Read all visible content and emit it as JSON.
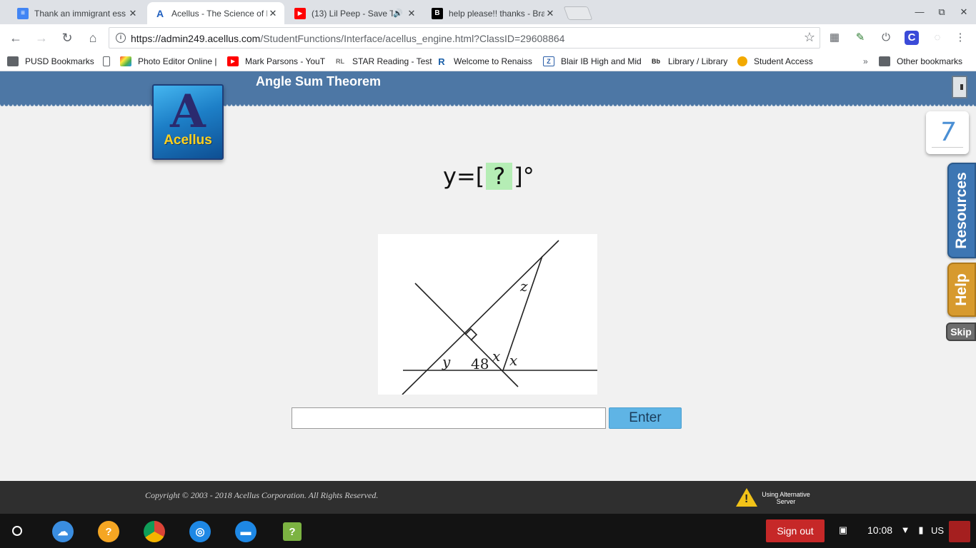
{
  "browser": {
    "tabs": [
      {
        "title": "Thank an immigrant ess",
        "favicon": "docs-icon",
        "color": "#4285f4",
        "glyph": "≡",
        "active": false
      },
      {
        "title": "Acellus - The Science of L",
        "favicon": "acellus-icon",
        "color": "#1f5fbf",
        "glyph": "A",
        "active": true
      },
      {
        "title": "(13) Lil Peep - Save T",
        "favicon": "youtube-icon",
        "color": "#ff0000",
        "glyph": "▶",
        "active": false,
        "audio": "🔊"
      },
      {
        "title": "help please!! thanks - Bra",
        "favicon": "brainly-icon",
        "color": "#000000",
        "glyph": "B",
        "active": false
      }
    ],
    "close_glyph": "✕",
    "window_controls": [
      "—",
      "⧉",
      "✕"
    ],
    "url_host": "https://admin249.acellus.com",
    "url_path": "/StudentFunctions/Interface/acellus_engine.html?ClassID=29608864",
    "nav": {
      "back": "←",
      "forward": "→",
      "reload": "↻",
      "home": "⌂",
      "info": "i",
      "star": "☆"
    },
    "extensions": [
      {
        "name": "qr-code-icon",
        "glyph": "▦"
      },
      {
        "name": "kami-icon",
        "glyph": "✎"
      },
      {
        "name": "power-icon",
        "glyph": "⏻"
      },
      {
        "name": "c-extension-icon",
        "glyph": "C"
      },
      {
        "name": "circle-extension-icon",
        "glyph": "◌"
      },
      {
        "name": "menu-icon",
        "glyph": "⋮"
      }
    ]
  },
  "bookmarks": {
    "items": [
      {
        "label": "PUSD Bookmarks",
        "icon": "folder-icon",
        "glyph": "▬",
        "color": "#5f6368"
      },
      {
        "label": "",
        "icon": "page-icon",
        "glyph": "▯",
        "color": "#ffffff"
      },
      {
        "label": "Photo Editor Online |",
        "icon": "photo-editor-icon",
        "glyph": "■",
        "color": "#e64a19"
      },
      {
        "label": "Mark Parsons - YouT",
        "icon": "youtube-icon",
        "glyph": "▶",
        "color": "#ff0000"
      },
      {
        "label": "STAR Reading - Test",
        "icon": "renaissance-rl-icon",
        "glyph": "RL",
        "color": "#8a8a8a"
      },
      {
        "label": "Welcome to Renaiss",
        "icon": "renaissance-icon",
        "glyph": "R",
        "color": "#1a5fa8"
      },
      {
        "label": "Blair IB High and Mid",
        "icon": "zangle-icon",
        "glyph": "Z",
        "color": "#2a5ea8"
      },
      {
        "label": "Library / Library",
        "icon": "blackboard-icon",
        "glyph": "Bb",
        "color": "#222222"
      },
      {
        "label": "Student Access",
        "icon": "student-access-icon",
        "glyph": "●",
        "color": "#f2a900"
      }
    ],
    "overflow": "»",
    "other": "Other bookmarks"
  },
  "acellus": {
    "lesson_title": "Angle Sum Theorem",
    "logo_letter": "A",
    "logo_text": "Acellus",
    "problem_count": "7",
    "side_tabs": {
      "resources": "Resources",
      "help": "Help",
      "skip": "Skip"
    },
    "question": {
      "prefix": "y=[",
      "placeholder": "?",
      "suffix": "]°"
    },
    "diagram_labels": {
      "z": "z",
      "y": "y",
      "angle": "48",
      "x1": "x",
      "x2": "x"
    },
    "answer_value": "",
    "enter_label": "Enter",
    "copyright": "Copyright © 2003 - 2018 Acellus Corporation.  All Rights Reserved.",
    "alt_server": "Using Alternative Server"
  },
  "shelf": {
    "apps": [
      {
        "name": "files-sync-app-icon",
        "color": "#3a8de0",
        "glyph": "☁"
      },
      {
        "name": "get-help-app-icon",
        "color": "#f5a623",
        "glyph": "?"
      },
      {
        "name": "chrome-app-icon",
        "color": "#db4437",
        "glyph": "◉"
      },
      {
        "name": "camera-app-icon",
        "color": "#1e88e5",
        "glyph": "◎"
      },
      {
        "name": "files-app-icon",
        "color": "#1e88e5",
        "glyph": "▬"
      },
      {
        "name": "help-app-icon",
        "color": "#7cb342",
        "glyph": "?"
      }
    ],
    "sign_out": "Sign out",
    "time": "10:08",
    "ime": "US",
    "tray": {
      "screenshot": "▣",
      "wifi": "▼",
      "battery": "▮"
    }
  },
  "colors": {
    "banner": "#4d77a5",
    "answer_box": "#b5edb5",
    "enter_button": "#5fb4e5",
    "sign_out": "#c62828"
  }
}
